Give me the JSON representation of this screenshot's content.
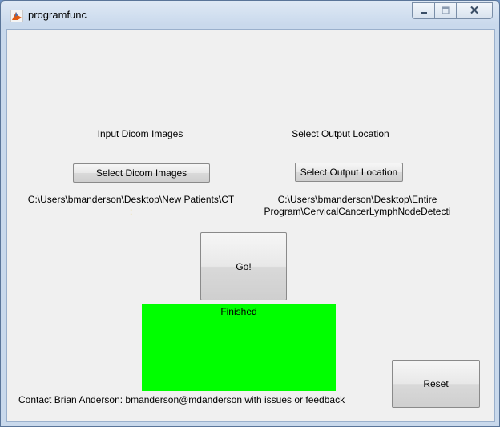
{
  "window": {
    "title": "programfunc",
    "app_icon": "matlab-icon",
    "caption_buttons": [
      "minimize-icon",
      "maximize-icon",
      "close-icon"
    ]
  },
  "input_section": {
    "label": "Input Dicom Images",
    "button_label": "Select Dicom Images",
    "path": "C:\\Users\\bmanderson\\Desktop\\New Patients\\CT",
    "path_extra": ":"
  },
  "output_section": {
    "label": "Select Output Location",
    "button_label": "Select Output Location",
    "path_line1": "C:\\Users\\bmanderson\\Desktop\\Entire",
    "path_line2": "Program\\CervicalCancerLymphNodeDetecti"
  },
  "go_button": {
    "label": "Go!"
  },
  "status": {
    "text": "Finished",
    "color": "#00ff00"
  },
  "reset_button": {
    "label": "Reset"
  },
  "contact": {
    "text": "Contact Brian Anderson: bmanderson@mdanderson with issues or feedback"
  }
}
